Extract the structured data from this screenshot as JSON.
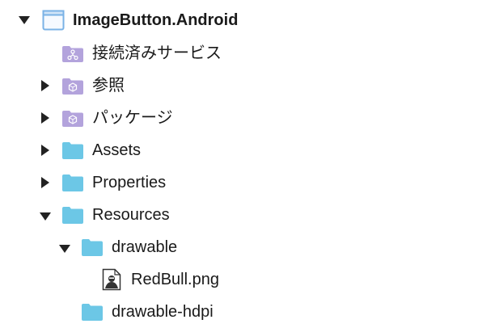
{
  "tree": {
    "project": {
      "label": "ImageButton.Android",
      "expanded": true,
      "icon": "project-icon"
    },
    "items": [
      {
        "id": "connected-services",
        "label": "接続済みサービス",
        "icon": "connected-services-folder-icon",
        "expandable": false
      },
      {
        "id": "references",
        "label": "参照",
        "icon": "references-folder-icon",
        "expandable": true,
        "expanded": false
      },
      {
        "id": "packages",
        "label": "パッケージ",
        "icon": "packages-folder-icon",
        "expandable": true,
        "expanded": false
      },
      {
        "id": "assets",
        "label": "Assets",
        "icon": "folder-icon",
        "expandable": true,
        "expanded": false
      },
      {
        "id": "properties",
        "label": "Properties",
        "icon": "folder-icon",
        "expandable": true,
        "expanded": false
      },
      {
        "id": "resources",
        "label": "Resources",
        "icon": "folder-icon",
        "expandable": true,
        "expanded": true
      },
      {
        "id": "drawable",
        "label": "drawable",
        "icon": "folder-icon",
        "expandable": true,
        "expanded": true
      },
      {
        "id": "redbull-png",
        "label": "RedBull.png",
        "icon": "image-file-icon",
        "expandable": false
      },
      {
        "id": "drawable-hdpi",
        "label": "drawable-hdpi",
        "icon": "folder-icon",
        "expandable": false
      }
    ]
  },
  "colors": {
    "folder_blue": "#6cc7e6",
    "folder_purple": "#b3a3dc",
    "project_border": "#7ab2e6",
    "text": "#1a1a1a"
  }
}
